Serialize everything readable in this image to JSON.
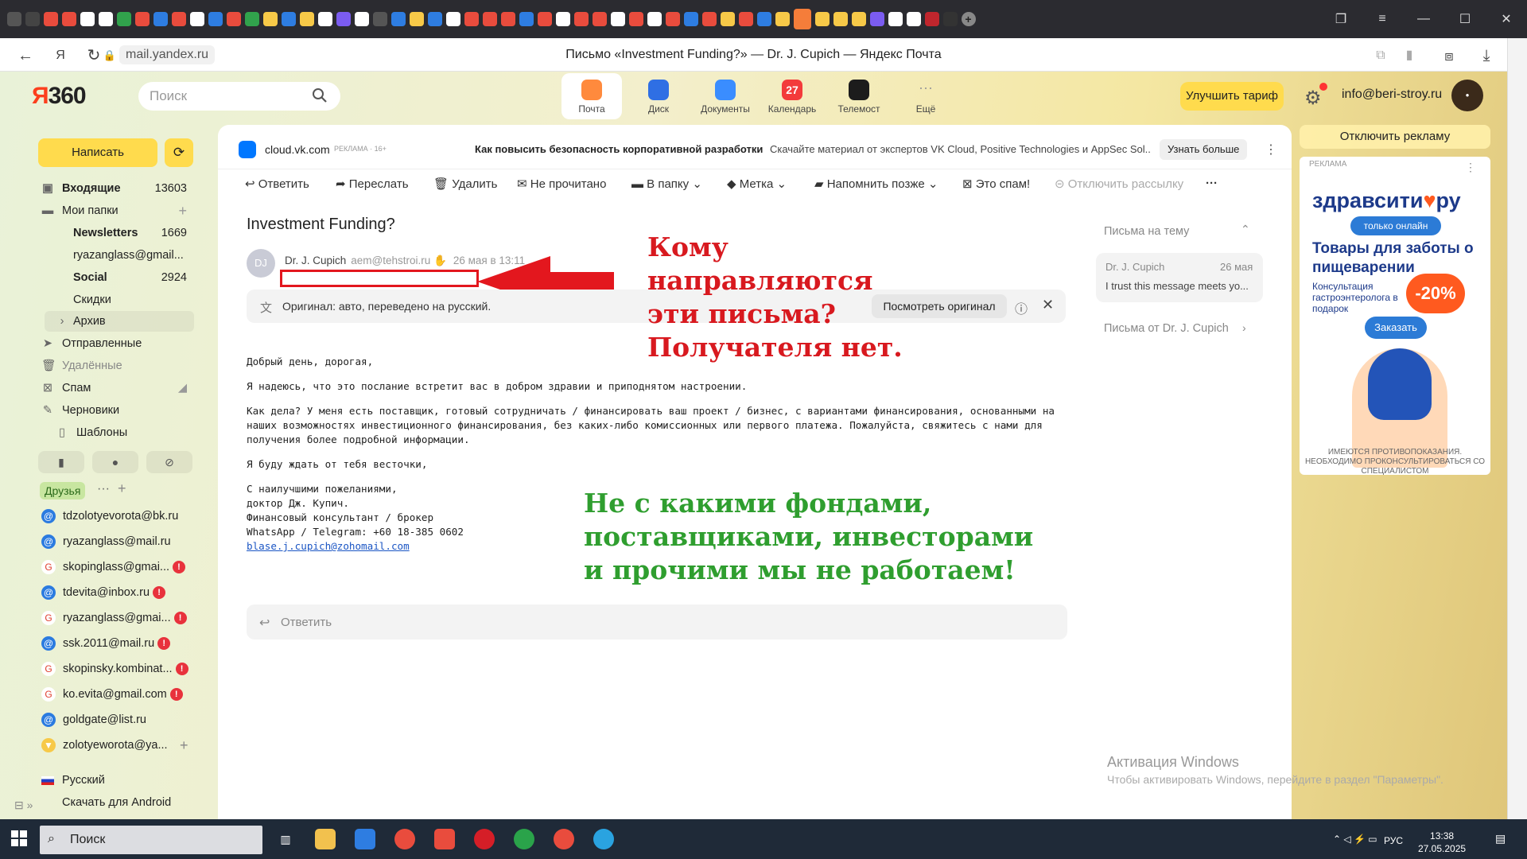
{
  "browser": {
    "address": "mail.yandex.ru",
    "page_title": "Письмо «Investment Funding?» — Dr. J. Cupich — Яндекс Почта"
  },
  "header": {
    "logo_ya": "Я",
    "logo_360": "360",
    "search_placeholder": "Поиск",
    "services": [
      {
        "label": "Почта",
        "color": "#ff8a3d"
      },
      {
        "label": "Диск",
        "color": "#2f6fe4"
      },
      {
        "label": "Документы",
        "color": "#3a8dff"
      },
      {
        "label": "Календарь",
        "color": "#f33b3b",
        "badge": "27"
      },
      {
        "label": "Телемост",
        "color": "#1c1c1c"
      },
      {
        "label": "Ещё",
        "color": "transparent"
      }
    ],
    "upgrade_label": "Улучшить тариф",
    "user_email": "info@beri-stroy.ru"
  },
  "sidebar": {
    "compose_label": "Написать",
    "folders": [
      {
        "label": "Входящие",
        "count": "13603"
      },
      {
        "label": "Мои папки"
      },
      {
        "label": "Newsletters",
        "count": "1669"
      },
      {
        "label": "ryazanglass@gmail..."
      },
      {
        "label": "Social",
        "count": "2924"
      },
      {
        "label": "Скидки"
      },
      {
        "label": "Архив"
      },
      {
        "label": "Отправленные"
      },
      {
        "label": "Удалённые"
      },
      {
        "label": "Спам"
      },
      {
        "label": "Черновики"
      },
      {
        "label": "Шаблоны"
      }
    ],
    "friends_label": "Друзья",
    "contacts": [
      {
        "label": "tdzolotyevorota@bk.ru",
        "type": "at",
        "warn": false
      },
      {
        "label": "ryazanglass@mail.ru",
        "type": "at",
        "warn": false
      },
      {
        "label": "skopinglass@gmai...",
        "type": "g",
        "warn": true
      },
      {
        "label": "tdevita@inbox.ru",
        "type": "at",
        "warn": true
      },
      {
        "label": "ryazanglass@gmai...",
        "type": "g",
        "warn": true
      },
      {
        "label": "ssk.2011@mail.ru",
        "type": "at",
        "warn": true
      },
      {
        "label": "skopinsky.kombinat...",
        "type": "g",
        "warn": true
      },
      {
        "label": "ko.evita@gmail.com",
        "type": "g",
        "warn": true
      },
      {
        "label": "goldgate@list.ru",
        "type": "at",
        "warn": false
      },
      {
        "label": "zolotyeworota@ya...",
        "type": "y",
        "warn": false
      }
    ],
    "language": "Русский",
    "android": "Скачать для Android"
  },
  "ad_bar": {
    "brand": "cloud.vk.com",
    "tag": "РЕКЛАМА · 16+",
    "headline": "Как повысить безопасность корпоративной разработки",
    "text": "Скачайте материал от экспертов VK Cloud, Positive Technologies и AppSec Sol...",
    "button": "Узнать больше"
  },
  "toolbar": {
    "reply": "Ответить",
    "forward": "Переслать",
    "delete": "Удалить",
    "unread": "Не прочитано",
    "to_folder": "В папку",
    "label": "Метка",
    "remind": "Напомнить позже",
    "spam": "Это спам!",
    "unsubscribe": "Отключить рассылку"
  },
  "message": {
    "subject": "Investment Funding?",
    "avatar": "DJ",
    "sender_name": "Dr. J. Cupich",
    "sender_email": "aem@tehstroi.ru",
    "date": "26 мая в 13:11",
    "translate_note": "Оригинал: авто, переведено на русский.",
    "show_original": "Посмотреть оригинал",
    "body": [
      "Добрый день, дорогая,",
      "Я надеюсь, что это послание встретит вас в добром здравии и приподнятом настроении.",
      "Как дела? У меня есть поставщик, готовый сотрудничать / финансировать ваш проект / бизнес, с вариантами финансирования, основанными на наших возможностях инвестиционного финансирования, без каких-либо комиссионных или первого платежа. Пожалуйста, свяжитесь с нами для получения более подробной информации.",
      "Я буду ждать от тебя весточки,"
    ],
    "signature": [
      "С наилучшими пожеланиями,",
      "доктор Дж. Купич.",
      "Финансовый консультант / брокер",
      "WhatsApp / Telegram: +60 18-385 0602"
    ],
    "signature_link": "blase.j.cupich@zohomail.com",
    "reply_label": "Ответить"
  },
  "thread": {
    "title": "Письма на тему",
    "from": "Dr. J. Cupich",
    "date": "26 мая",
    "snippet": "I trust this message meets yo...",
    "from_sender": "Письма от Dr. J. Cupich"
  },
  "annotations": {
    "red": [
      "Кому",
      "направляются",
      "эти письма?",
      "Получателя нет."
    ],
    "green": [
      "Не с какими фондами,",
      "поставщиками, инвесторами",
      "и прочими мы не работаем!"
    ]
  },
  "right_ad": {
    "disable": "Отключить рекламу",
    "label": "РЕКЛАМА",
    "brand_a": "здравсити",
    "brand_b": "ру",
    "pill": "только онлайн",
    "headline": "Товары для заботы о пищеварении",
    "sub": "Консультация гастроэнтеролога в подарок",
    "discount": "-20%",
    "order": "Заказать",
    "warning": "ИМЕЮТСЯ ПРОТИВОПОКАЗАНИЯ. НЕОБХОДИМО ПРОКОНСУЛЬТИРОВАТЬСЯ СО СПЕЦИАЛИСТОМ"
  },
  "windows": {
    "activation_title": "Активация Windows",
    "activation_text": "Чтобы активировать Windows, перейдите в раздел \"Параметры\".",
    "search": "Поиск",
    "lang": "РУС",
    "time": "13:38",
    "date": "27.05.2025"
  }
}
